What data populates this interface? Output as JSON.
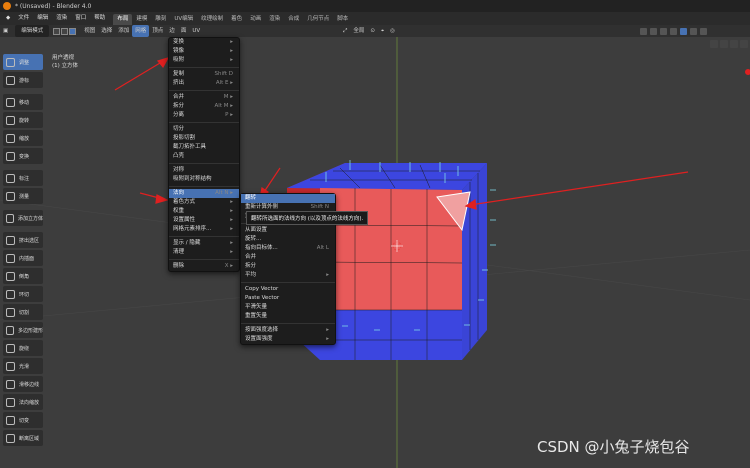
{
  "window": {
    "title": "* (Unsaved) - Blender 4.0"
  },
  "menubar": {
    "items": [
      "文件",
      "编辑",
      "渲染",
      "窗口",
      "帮助"
    ]
  },
  "workspaces": [
    "布局",
    "建模",
    "雕刻",
    "UV编辑",
    "纹理绘制",
    "着色",
    "动画",
    "渲染",
    "合成",
    "几何节点",
    "脚本"
  ],
  "header": {
    "mode": "编辑模式",
    "menus": [
      "视图",
      "选择",
      "添加",
      "网格",
      "顶点",
      "边",
      "面",
      "UV"
    ],
    "transform_orientation": "全局"
  },
  "overlay": {
    "view": "用户透视",
    "object": "(1) 立方体"
  },
  "toolbar": [
    "调整",
    "游标",
    "移动",
    "旋转",
    "缩放",
    "变换",
    "标注",
    "测量",
    "添加立方体",
    "挤出选区",
    "内插面",
    "倒角",
    "环切",
    "切割",
    "多边形建形",
    "旋绕",
    "光滑",
    "滑移边线",
    "法向缩放",
    "切变",
    "断离区域"
  ],
  "mesh_menu": [
    {
      "label": "变换",
      "shortcut": "▸"
    },
    {
      "label": "镜像",
      "shortcut": "▸"
    },
    {
      "label": "吸附",
      "shortcut": "▸"
    },
    {
      "sep": true
    },
    {
      "label": "复制",
      "shortcut": "Shift D"
    },
    {
      "label": "挤出",
      "shortcut": "Alt E ▸"
    },
    {
      "sep": true
    },
    {
      "label": "合并",
      "shortcut": "M ▸"
    },
    {
      "label": "拆分",
      "shortcut": "Alt M ▸"
    },
    {
      "label": "分离",
      "shortcut": "P ▸"
    },
    {
      "sep": true
    },
    {
      "label": "切分",
      "shortcut": ""
    },
    {
      "label": "投影切割",
      "shortcut": ""
    },
    {
      "label": "截刀拓扑工具",
      "shortcut": ""
    },
    {
      "label": "凸壳",
      "shortcut": ""
    },
    {
      "sep": true
    },
    {
      "label": "对称",
      "shortcut": ""
    },
    {
      "label": "吸附到对称结构",
      "shortcut": ""
    },
    {
      "sep": true
    },
    {
      "label": "法向",
      "shortcut": "Alt N ▸",
      "hl": true
    },
    {
      "label": "着色方式",
      "shortcut": "▸"
    },
    {
      "label": "权重",
      "shortcut": "▸"
    },
    {
      "label": "设置属性",
      "shortcut": "▸"
    },
    {
      "label": "网格元素排序...",
      "shortcut": "▸"
    },
    {
      "sep": true
    },
    {
      "label": "显示 / 隐藏",
      "shortcut": "▸"
    },
    {
      "label": "清理",
      "shortcut": "▸"
    },
    {
      "sep": true
    },
    {
      "label": "删除",
      "shortcut": "X ▸"
    }
  ],
  "normals_menu": [
    {
      "label": "翻转",
      "shortcut": "",
      "hl": true
    },
    {
      "label": "重新计算外侧",
      "shortcut": "Shift N"
    },
    {
      "label": "重新计算内侧",
      "shortcut": ""
    },
    {
      "sep": true
    },
    {
      "label": "从面设置",
      "shortcut": ""
    },
    {
      "label": "旋转...",
      "shortcut": ""
    },
    {
      "label": "指向目标体...",
      "shortcut": "Alt L"
    },
    {
      "label": "合并",
      "shortcut": ""
    },
    {
      "label": "拆分",
      "shortcut": ""
    },
    {
      "label": "平均",
      "shortcut": "▸"
    },
    {
      "sep": true
    },
    {
      "label": "Copy Vector",
      "shortcut": ""
    },
    {
      "label": "Paste Vector",
      "shortcut": ""
    },
    {
      "label": "平滑矢量",
      "shortcut": ""
    },
    {
      "label": "重置矢量",
      "shortcut": ""
    },
    {
      "sep": true
    },
    {
      "label": "按面强度选择",
      "shortcut": "▸"
    },
    {
      "label": "设置面强度",
      "shortcut": "▸"
    }
  ],
  "tooltip": "翻转所选面的法线方向 (以及顶点的法线方向).",
  "watermark": "CSDN @小兔子烧包谷",
  "colors": {
    "selected_face": "#e85a5a",
    "unselected_face": "#3c46e0",
    "accent": "#4772b3"
  }
}
